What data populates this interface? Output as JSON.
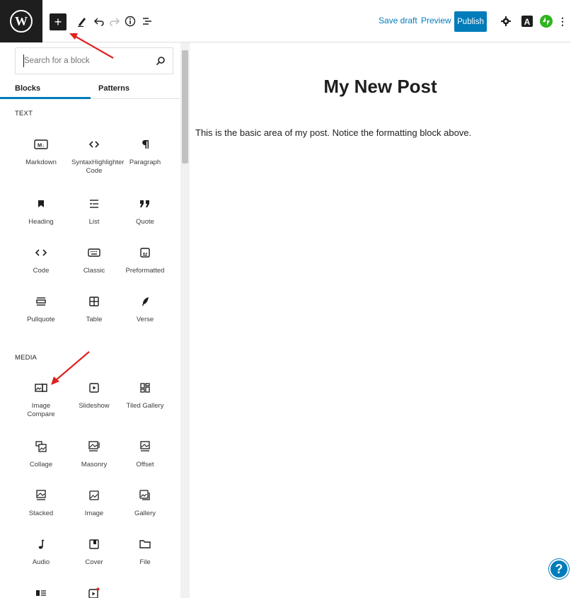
{
  "toolbar": {
    "save_draft": "Save draft",
    "preview": "Preview",
    "publish": "Publish",
    "add_symbol": "+",
    "more_symbol": "⋮"
  },
  "inserter": {
    "search_placeholder": "Search for a block",
    "tabs": [
      "Blocks",
      "Patterns"
    ],
    "sections": [
      {
        "title": "TEXT",
        "blocks": [
          "Markdown",
          "SyntaxHighlighter Code",
          "Paragraph",
          "Heading",
          "List",
          "Quote",
          "Code",
          "Classic",
          "Preformatted",
          "Pullquote",
          "Table",
          "Verse"
        ]
      },
      {
        "title": "MEDIA",
        "blocks": [
          "Image Compare",
          "Slideshow",
          "Tiled Gallery",
          "Collage",
          "Masonry",
          "Offset",
          "Stacked",
          "Image",
          "Gallery",
          "Audio",
          "Cover",
          "File"
        ]
      }
    ]
  },
  "editor": {
    "title": "My New Post",
    "body": "This is the basic area of my post. Notice the formatting block above."
  },
  "help_label": "?",
  "colors": {
    "accent": "#007cba",
    "annotation": "#e02020"
  }
}
